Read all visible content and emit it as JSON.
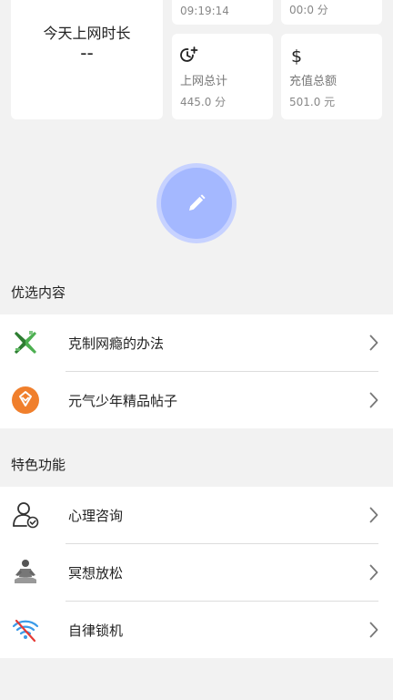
{
  "today": {
    "title": "今天上网时长",
    "value": "--"
  },
  "top_partial": {
    "left": "09:19:14",
    "right": "00:0 分"
  },
  "stats": {
    "online_total": {
      "icon": "clock-plus-icon",
      "label": "上网总计",
      "value": "445.0 分"
    },
    "recharge_total": {
      "icon": "dollar-icon",
      "label": "充值总额",
      "value": "501.0 元"
    }
  },
  "fab": {
    "icon": "pencil-icon",
    "color": "#a4b8ff"
  },
  "featured": {
    "title": "优选内容",
    "items": [
      {
        "label": "克制网瘾的办法",
        "icon": "green-x-icon"
      },
      {
        "label": "元气少年精品帖子",
        "icon": "orange-diamond-badge-icon"
      }
    ]
  },
  "features": {
    "title": "特色功能",
    "items": [
      {
        "label": "心理咨询",
        "icon": "person-check-icon"
      },
      {
        "label": "冥想放松",
        "icon": "meditation-icon"
      },
      {
        "label": "自律锁机",
        "icon": "wifi-lock-icon"
      }
    ]
  }
}
